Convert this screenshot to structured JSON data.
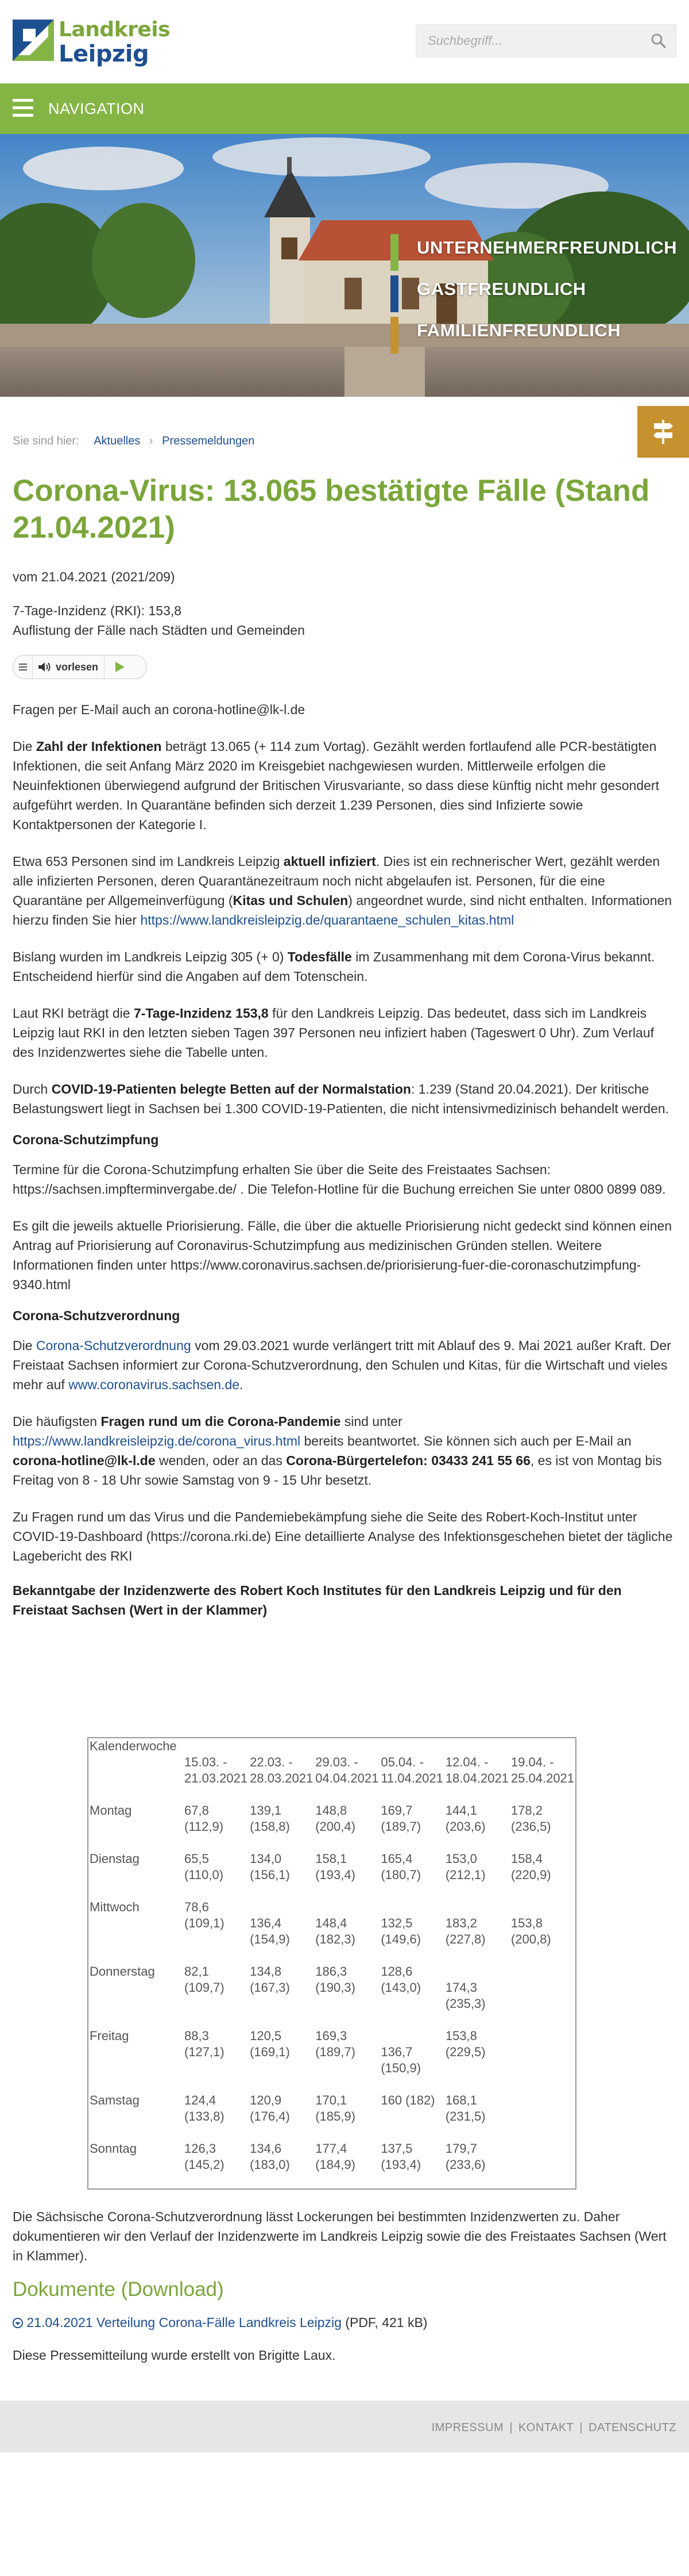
{
  "header": {
    "logo": {
      "line1": "Landkreis",
      "line2": "Leipzig"
    },
    "search_placeholder": "Suchbegriff..."
  },
  "nav": {
    "label": "NAVIGATION"
  },
  "hero": {
    "slogans": [
      {
        "text": "UNTERNEHMERFREUNDLICH",
        "color": "#84b544"
      },
      {
        "text": "GASTFREUNDLICH",
        "color": "#1d4f91"
      },
      {
        "text": "FAMILIENFREUNDLICH",
        "color": "#c5922f"
      }
    ]
  },
  "breadcrumb": {
    "prefix": "Sie sind hier:",
    "items": [
      "Aktuelles",
      "Pressemeldungen"
    ],
    "separator": "›"
  },
  "article": {
    "title": "Corona-Virus: 13.065 bestätigte Fälle (Stand 21.04.2021)",
    "meta": "vom 21.04.2021 (2021/209)",
    "sub_line1": "7-Tage-Inzidenz (RKI): 153,8",
    "sub_line2": "Auflistung der Fälle nach Städten und Gemeinden",
    "readspeaker_label": "vorlesen",
    "p_contact": "Fragen per E-Mail auch an corona-hotline@lk-l.de",
    "p1_a": "Die ",
    "p1_b": "Zahl der Infektionen",
    "p1_c": " beträgt 13.065 (+ 114 zum Vortag). Gezählt werden fortlaufend alle PCR-bestätigten Infektionen, die seit Anfang März 2020 im Kreisgebiet nachgewiesen wurden. Mittlerweile erfolgen die Neuinfektionen überwiegend aufgrund der Britischen Virusvariante, so dass diese künftig nicht mehr gesondert aufgeführt werden. In Quarantäne befinden sich derzeit 1.239 Personen, dies sind Infizierte sowie Kontaktpersonen der Kategorie I.",
    "p2_a": "Etwa 653 Personen sind im Landkreis Leipzig ",
    "p2_b": "aktuell infiziert",
    "p2_c": ". Dies ist ein rechnerischer Wert, gezählt werden alle infizierten Personen, deren Quarantänezeitraum noch nicht abgelaufen ist. Personen, für die eine Quarantäne per Allgemeinverfügung (",
    "p2_d": "Kitas und Schulen",
    "p2_e": ") angeordnet wurde, sind nicht enthalten. Informationen hierzu finden Sie hier ",
    "p2_link": "https://www.landkreisleipzig.de/quarantaene_schulen_kitas.html",
    "p3_a": "Bislang wurden im Landkreis Leipzig 305 (+ 0) ",
    "p3_b": "Todesfälle",
    "p3_c": " im Zusammenhang mit dem Corona-Virus bekannt. Entscheidend hierfür sind die Angaben auf dem Totenschein.",
    "p4_a": "Laut RKI beträgt die ",
    "p4_b": "7-Tage-Inzidenz 153,8",
    "p4_c": " für den Landkreis Leipzig. Das bedeutet, dass sich im Landkreis Leipzig laut RKI in den letzten sieben Tagen 397 Personen neu infiziert haben (Tageswert 0 Uhr). Zum Verlauf des Inzidenzwertes siehe die Tabelle unten.",
    "p5_a": "Durch ",
    "p5_b": "COVID-19-Patienten belegte Betten auf der Normalstation",
    "p5_c": ": 1.239 (Stand 20.04.2021). Der kritische Belastungswert liegt in Sachsen bei 1.300 COVID-19-Patienten, die nicht intensivmedizinisch behandelt werden.",
    "h_impf": "Corona-Schutzimpfung",
    "p6": "Termine für die Corona-Schutzimpfung erhalten Sie über die Seite des Freistaates Sachsen: https://sachsen.impfterminvergabe.de/ . Die Telefon-Hotline für die Buchung erreichen Sie unter 0800 0899 089.",
    "p7": "Es gilt die jeweils aktuelle Priorisierung. Fälle, die über die aktuelle Priorisierung nicht gedeckt sind können einen Antrag auf Priorisierung auf Coronavirus-Schutzimpfung aus medizinischen Gründen stellen. Weitere Informationen finden unter https://www.coronavirus.sachsen.de/priorisierung-fuer-die-coronaschutzimpfung-9340.html",
    "h_vo": "Corona-Schutzverordnung",
    "p8_a": "Die  ",
    "p8_link1": "Corona-Schutzverordnung",
    "p8_b": " vom 29.03.2021 wurde verlängert tritt mit Ablauf des 9. Mai 2021 außer Kraft. Der Freistaat Sachsen informiert zur Corona-Schutzverordnung, den Schulen und Kitas, für die Wirtschaft und vieles mehr auf ",
    "p8_link2": "www.coronavirus.sachsen.de",
    "p8_c": ".",
    "p9_a": "Die häufigsten ",
    "p9_b": "Fragen rund um die Corona-Pandemie",
    "p9_c": " sind unter ",
    "p9_link": "https://www.landkreisleipzig.de/corona_virus.html",
    "p9_d": " bereits beantwortet. Sie können sich auch per E-Mail an ",
    "p9_e": "corona-hotline@lk-l.de",
    "p9_f": " wenden, oder an das ",
    "p9_g": "Corona-Bürgertelefon: 03433 241 55 66",
    "p9_h": ", es ist von Montag bis Freitag von 8 - 18 Uhr sowie Samstag von 9 - 15 Uhr besetzt.",
    "p10": "Zu Fragen rund um das Virus und die Pandemiebekämpfung siehe die Seite des Robert-Koch-Institut unter COVID-19-Dashboard (https://corona.rki.de)  Eine detaillierte Analyse des Infektionsgeschehen bietet der tägliche Lagebericht des RKI",
    "h_table": "Bekanntgabe der Inzidenzwerte des Robert Koch Institutes für den Landkreis Leipzig und für den Freistaat Sachsen (Wert in der Klammer)"
  },
  "table": {
    "header_label": "Kalenderwoche",
    "weeks": [
      [
        "15.03. -",
        "21.03.2021"
      ],
      [
        "22.03. -",
        "28.03.2021"
      ],
      [
        "29.03. -",
        "04.04.2021"
      ],
      [
        "05.04. -",
        "11.04.2021"
      ],
      [
        "12.04. -",
        "18.04.2021"
      ],
      [
        "19.04. -",
        "25.04.2021"
      ]
    ],
    "rows": [
      {
        "day": "Montag",
        "cells": [
          [
            "67,8",
            "(112,9)"
          ],
          [
            "139,1",
            "(158,8)"
          ],
          [
            "148,8",
            "(200,4)"
          ],
          [
            "169,7",
            "(189,7)"
          ],
          [
            "144,1",
            "(203,6)"
          ],
          [
            "178,2",
            "(236,5)"
          ]
        ]
      },
      {
        "day": "Dienstag",
        "cells": [
          [
            "65,5",
            "(110,0)"
          ],
          [
            "134,0",
            "(156,1)"
          ],
          [
            "158,1",
            "(193,4)"
          ],
          [
            "165,4",
            "(180,7)"
          ],
          [
            "153,0",
            "(212,1)"
          ],
          [
            "158,4",
            "(220,9)"
          ]
        ]
      },
      {
        "day": "Mittwoch",
        "cells": [
          [
            "78,6",
            "(109,1)"
          ],
          [
            "",
            "136,4",
            "(154,9)"
          ],
          [
            "",
            "148,4",
            "(182,3)"
          ],
          [
            "",
            "132,5",
            "(149,6)"
          ],
          [
            "",
            "183,2",
            "(227,8)"
          ],
          [
            "",
            "153,8",
            "(200,8)"
          ]
        ]
      },
      {
        "day": "Donnerstag",
        "cells": [
          [
            "82,1",
            "(109,7)"
          ],
          [
            "134,8",
            "(167,3)"
          ],
          [
            "186,3",
            "(190,3)"
          ],
          [
            "128,6",
            "(143,0)"
          ],
          [
            "",
            "174,3",
            "(235,3)"
          ],
          []
        ]
      },
      {
        "day": "Freitag",
        "cells": [
          [
            "88,3",
            "(127,1)"
          ],
          [
            "120,5",
            "(169,1)"
          ],
          [
            "169,3",
            "(189,7)"
          ],
          [
            "",
            "136,7",
            "(150,9)"
          ],
          [
            "153,8",
            "(229,5)"
          ],
          []
        ]
      },
      {
        "day": "Samstag",
        "cells": [
          [
            "124,4",
            "(133,8)"
          ],
          [
            "120,9",
            "(176,4)"
          ],
          [
            "170,1",
            "(185,9)"
          ],
          [
            "160 (182)"
          ],
          [
            "168,1",
            "(231,5)"
          ],
          []
        ]
      },
      {
        "day": "Sonntag",
        "cells": [
          [
            "126,3",
            "(145,2)"
          ],
          [
            "134,6",
            "(183,0)"
          ],
          [
            "177,4",
            "(184,9)"
          ],
          [
            "137,5",
            "(193,4)"
          ],
          [
            "179,7",
            "(233,6)"
          ],
          []
        ]
      }
    ]
  },
  "after": {
    "p_lockerung": "Die Sächsische Corona-Schutzverordnung lässt Lockerungen bei bestimmten Inzidenzwerten zu. Daher dokumentieren wir den Verlauf der Inzidenzwerte im Landkreis Leipzig sowie die des Freistaates Sachsen (Wert in Klammer).",
    "downloads_heading": "Dokumente (Download)",
    "download_link": "21.04.2021 Verteilung Corona-Fälle Landkreis Leipzig",
    "download_meta": "(PDF, 421 kB)",
    "author": "Diese Pressemitteilung wurde erstellt von Brigitte Laux."
  },
  "footer": {
    "links": [
      "IMPRESSUM",
      "KONTAKT",
      "DATENSCHUTZ"
    ]
  },
  "colors": {
    "green": "#84b544",
    "title_green": "#7aa63a",
    "blue": "#1d4f91",
    "gold": "#c5922f"
  }
}
